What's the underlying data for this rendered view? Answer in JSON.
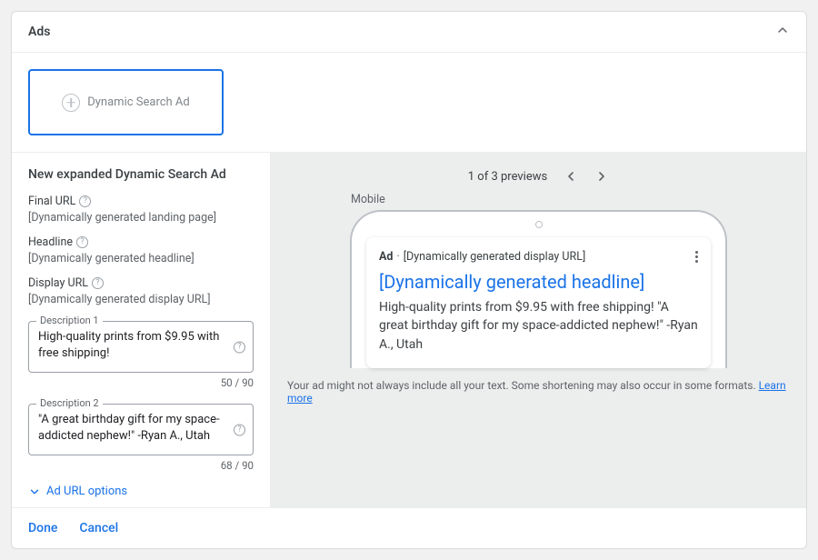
{
  "header": {
    "title": "Ads"
  },
  "ad_type": {
    "label": "Dynamic Search Ad"
  },
  "form": {
    "title": "New expanded Dynamic Search Ad",
    "final_url_label": "Final URL",
    "final_url_value": "[Dynamically generated landing page]",
    "headline_label": "Headline",
    "headline_value": "[Dynamically generated headline]",
    "display_url_label": "Display URL",
    "display_url_value": "[Dynamically generated display URL]",
    "description1_label": "Description 1",
    "description1_value": "High-quality prints from $9.95 with free shipping!",
    "description1_counter": "50 / 90",
    "description2_label": "Description 2",
    "description2_value": "\"A great birthday gift for my space-addicted nephew!\" -Ryan A., Utah",
    "description2_counter": "68 / 90",
    "url_options": "Ad URL options"
  },
  "preview": {
    "counter": "1 of 3 previews",
    "mobile_label": "Mobile",
    "ad_badge": "Ad",
    "ad_display_url": "[Dynamically generated display URL]",
    "ad_headline": "[Dynamically generated headline]",
    "ad_description": "High-quality prints from $9.95 with free shipping! \"A great birthday gift for my space-addicted nephew!\" -Ryan A., Utah",
    "disclaimer_text": "Your ad might not always include all your text. Some shortening may also occur in some formats. ",
    "disclaimer_link": "Learn more"
  },
  "footer": {
    "done": "Done",
    "cancel": "Cancel"
  }
}
